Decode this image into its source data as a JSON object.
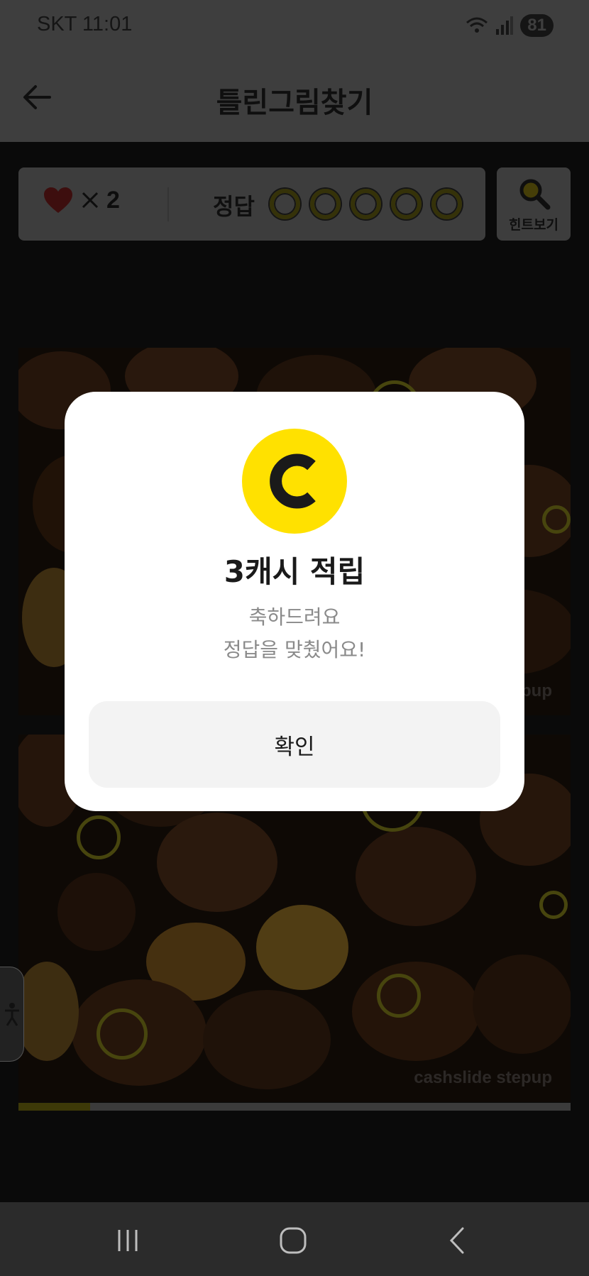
{
  "status_bar": {
    "time": "SKT 11:01",
    "battery": "81",
    "icons": [
      "wifi-icon",
      "signal-icon",
      "battery-icon"
    ]
  },
  "app_bar": {
    "title": "틀린그림찾기",
    "back_icon": "arrow-left-icon"
  },
  "game": {
    "lives_icon": "heart-icon",
    "lives_count": "2",
    "answer_label": "정답",
    "answers_found": 5,
    "answers_total": 5,
    "hint_label": "힌트보기",
    "hint_icon": "magnifier-icon",
    "watermark": "cashslide stepup",
    "progress": 0.13,
    "colors": {
      "accent": "#ffe100",
      "heart": "#d32f2f"
    }
  },
  "modal": {
    "coin_letter": "C",
    "title": "3캐시 적립",
    "message_line1": "축하드려요",
    "message_line2": "정답을 맞췄어요!",
    "confirm_label": "확인"
  },
  "nav_bar": {
    "icons": [
      "recents-icon",
      "home-icon",
      "back-icon"
    ]
  }
}
